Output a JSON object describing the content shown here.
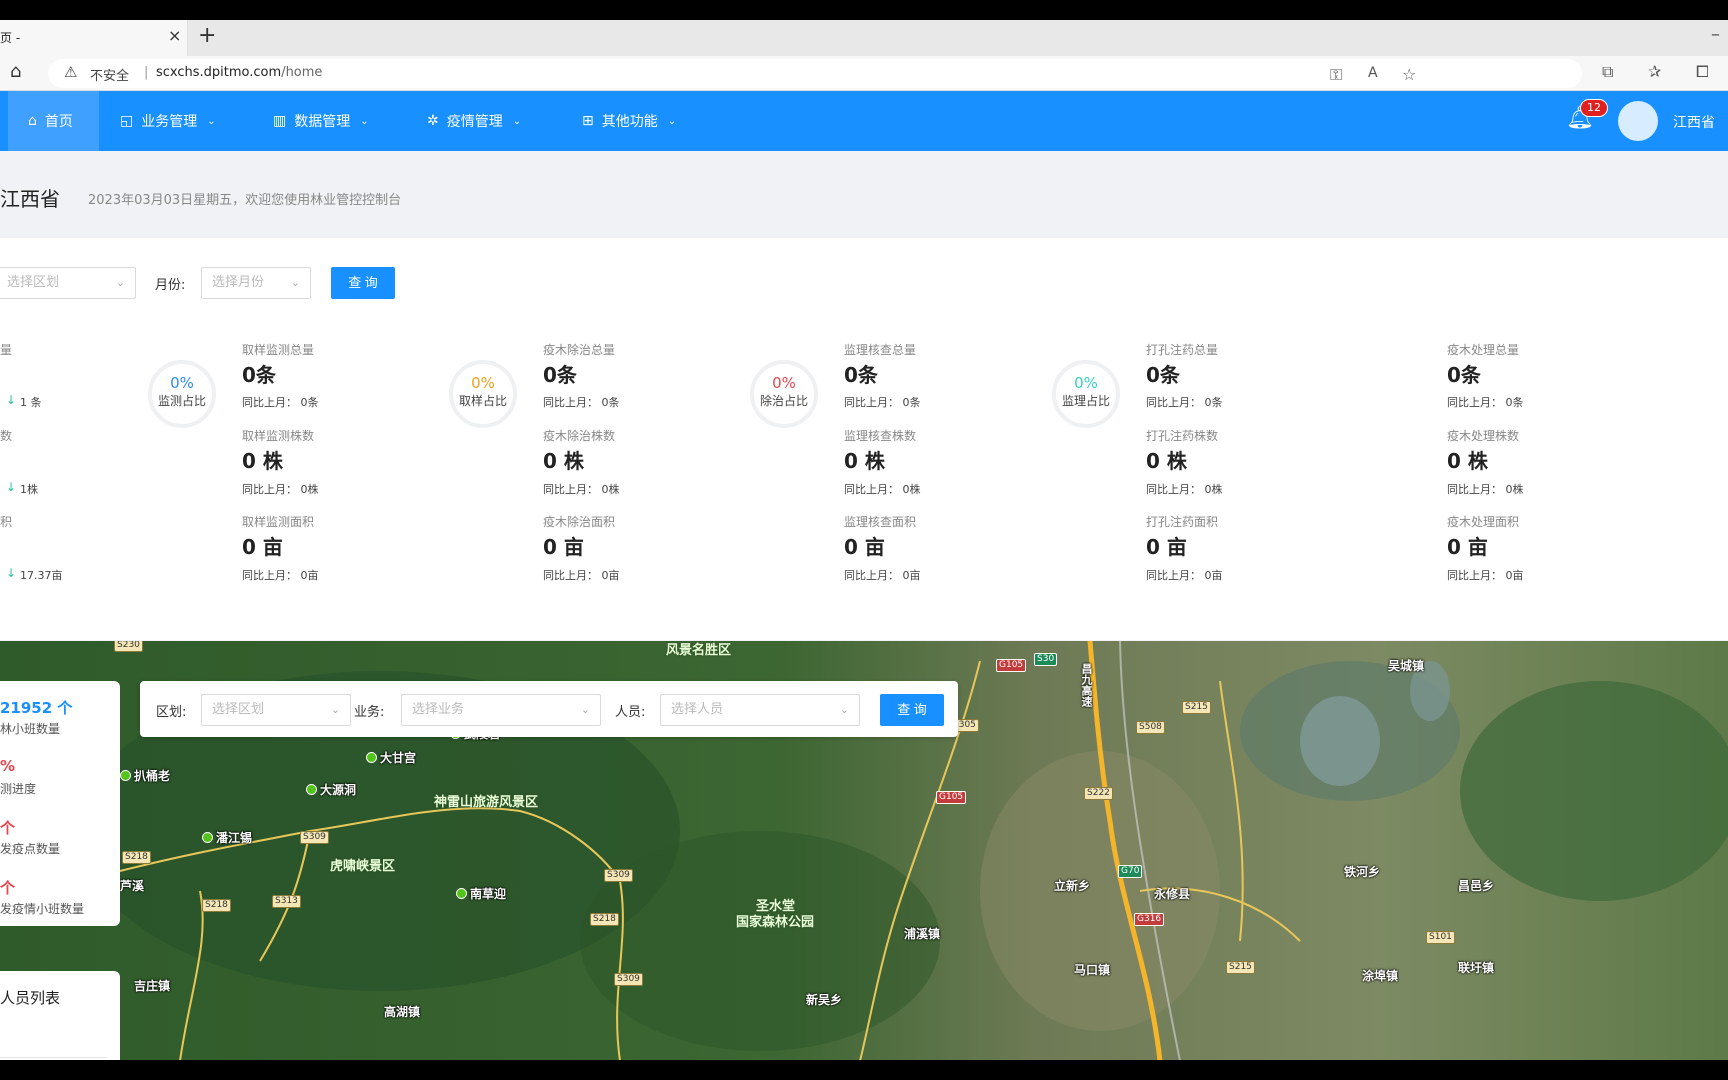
{
  "browser": {
    "tab_title": "页 -",
    "insecure_label": "不安全",
    "url_host": "scxchs.dpitmo.com",
    "url_path": "/home"
  },
  "nav": {
    "items": [
      {
        "label": "首页",
        "icon": "home-icon"
      },
      {
        "label": "业务管理",
        "icon": "chart-icon"
      },
      {
        "label": "数据管理",
        "icon": "bar-chart-icon"
      },
      {
        "label": "疫情管理",
        "icon": "bug-icon"
      },
      {
        "label": "其他功能",
        "icon": "grid-icon"
      }
    ],
    "notification_count": "12",
    "user_name": "江西省"
  },
  "header": {
    "title": "江西省",
    "subtitle": "2023年03月03日星期五，欢迎您使用林业管控控制台"
  },
  "filters": {
    "region_placeholder": "选择区划",
    "month_label": "月份:",
    "month_placeholder": "选择月份",
    "query_label": "查 询"
  },
  "left_partial": {
    "labels": [
      "量",
      "数",
      "积"
    ],
    "cmps": [
      "1 条",
      "1株",
      "17.37亩"
    ]
  },
  "rings": [
    {
      "pct": "0%",
      "label": "监测占比",
      "color": "#2d8cf0"
    },
    {
      "pct": "0%",
      "label": "取样占比",
      "color": "#f0a020"
    },
    {
      "pct": "0%",
      "label": "除治占比",
      "color": "#e8454f"
    },
    {
      "pct": "0%",
      "label": "监理占比",
      "color": "#36cfc9"
    }
  ],
  "stat_groups": [
    {
      "rows": [
        {
          "label": "取样监测总量",
          "value": "0条",
          "cmp": "同比上月：  0条"
        },
        {
          "label": "取样监测株数",
          "value": "0 株",
          "cmp": "同比上月：  0株"
        },
        {
          "label": "取样监测面积",
          "value": "0 亩",
          "cmp": "同比上月：  0亩"
        }
      ]
    },
    {
      "rows": [
        {
          "label": "疫木除治总量",
          "value": "0条",
          "cmp": "同比上月：  0条"
        },
        {
          "label": "疫木除治株数",
          "value": "0 株",
          "cmp": "同比上月：  0株"
        },
        {
          "label": "疫木除治面积",
          "value": "0 亩",
          "cmp": "同比上月：  0亩"
        }
      ]
    },
    {
      "rows": [
        {
          "label": "监理核查总量",
          "value": "0条",
          "cmp": "同比上月：  0条"
        },
        {
          "label": "监理核查株数",
          "value": "0 株",
          "cmp": "同比上月：  0株"
        },
        {
          "label": "监理核查面积",
          "value": "0 亩",
          "cmp": "同比上月：  0亩"
        }
      ]
    },
    {
      "rows": [
        {
          "label": "打孔注药总量",
          "value": "0条",
          "cmp": "同比上月：  0条"
        },
        {
          "label": "打孔注药株数",
          "value": "0 株",
          "cmp": "同比上月：  0株"
        },
        {
          "label": "打孔注药面积",
          "value": "0 亩",
          "cmp": "同比上月：  0亩"
        }
      ]
    },
    {
      "rows": [
        {
          "label": "疫木处理总量",
          "value": "0条",
          "cmp": "同比上月：  0条"
        },
        {
          "label": "疫木处理株数",
          "value": "0 株",
          "cmp": "同比上月：  0株"
        },
        {
          "label": "疫木处理面积",
          "value": "0 亩",
          "cmp": "同比上月：  0亩"
        }
      ]
    }
  ],
  "map_search": {
    "region_label": "区划:",
    "region_placeholder": "选择区划",
    "business_label": "业务:",
    "business_placeholder": "选择业务",
    "person_label": "人员:",
    "person_placeholder": "选择人员",
    "query_label": "查 询"
  },
  "side_stats": [
    {
      "value": "21952 个",
      "label": "林小班数量",
      "color": "#1890ff"
    },
    {
      "value": "%",
      "label": "测进度",
      "color": "#e8454f"
    },
    {
      "value": "个",
      "label": "发疫点数量",
      "color": "#e8454f"
    },
    {
      "value": "个",
      "label": "发疫情小班数量",
      "color": "#e8454f"
    }
  ],
  "people": {
    "title": "人员列表"
  },
  "map_labels": {
    "places": [
      "武陵岩",
      "大甘宫",
      "扒桶老",
      "大源洞",
      "潘江锡",
      "南草迎"
    ],
    "areas": [
      "风景名胜区",
      "神雷山旅游风景区",
      "虎啸峡景区",
      "圣水堂",
      "国家森林公园"
    ],
    "towns": [
      "芦溪",
      "吉庄镇",
      "高湖镇",
      "浦溪镇",
      "新吴乡",
      "马口镇",
      "永修县",
      "立新乡",
      "吴城镇",
      "铁河乡",
      "昌邑乡",
      "涂埠镇",
      "联圩镇"
    ],
    "roads": [
      "S230",
      "G105",
      "S30",
      "S305",
      "S215",
      "S508",
      "G105",
      "S222",
      "S309",
      "S218",
      "S313",
      "S218",
      "S309",
      "S218",
      "S309",
      "G70",
      "G316",
      "S215",
      "S101"
    ],
    "highway": "昌九高速"
  }
}
